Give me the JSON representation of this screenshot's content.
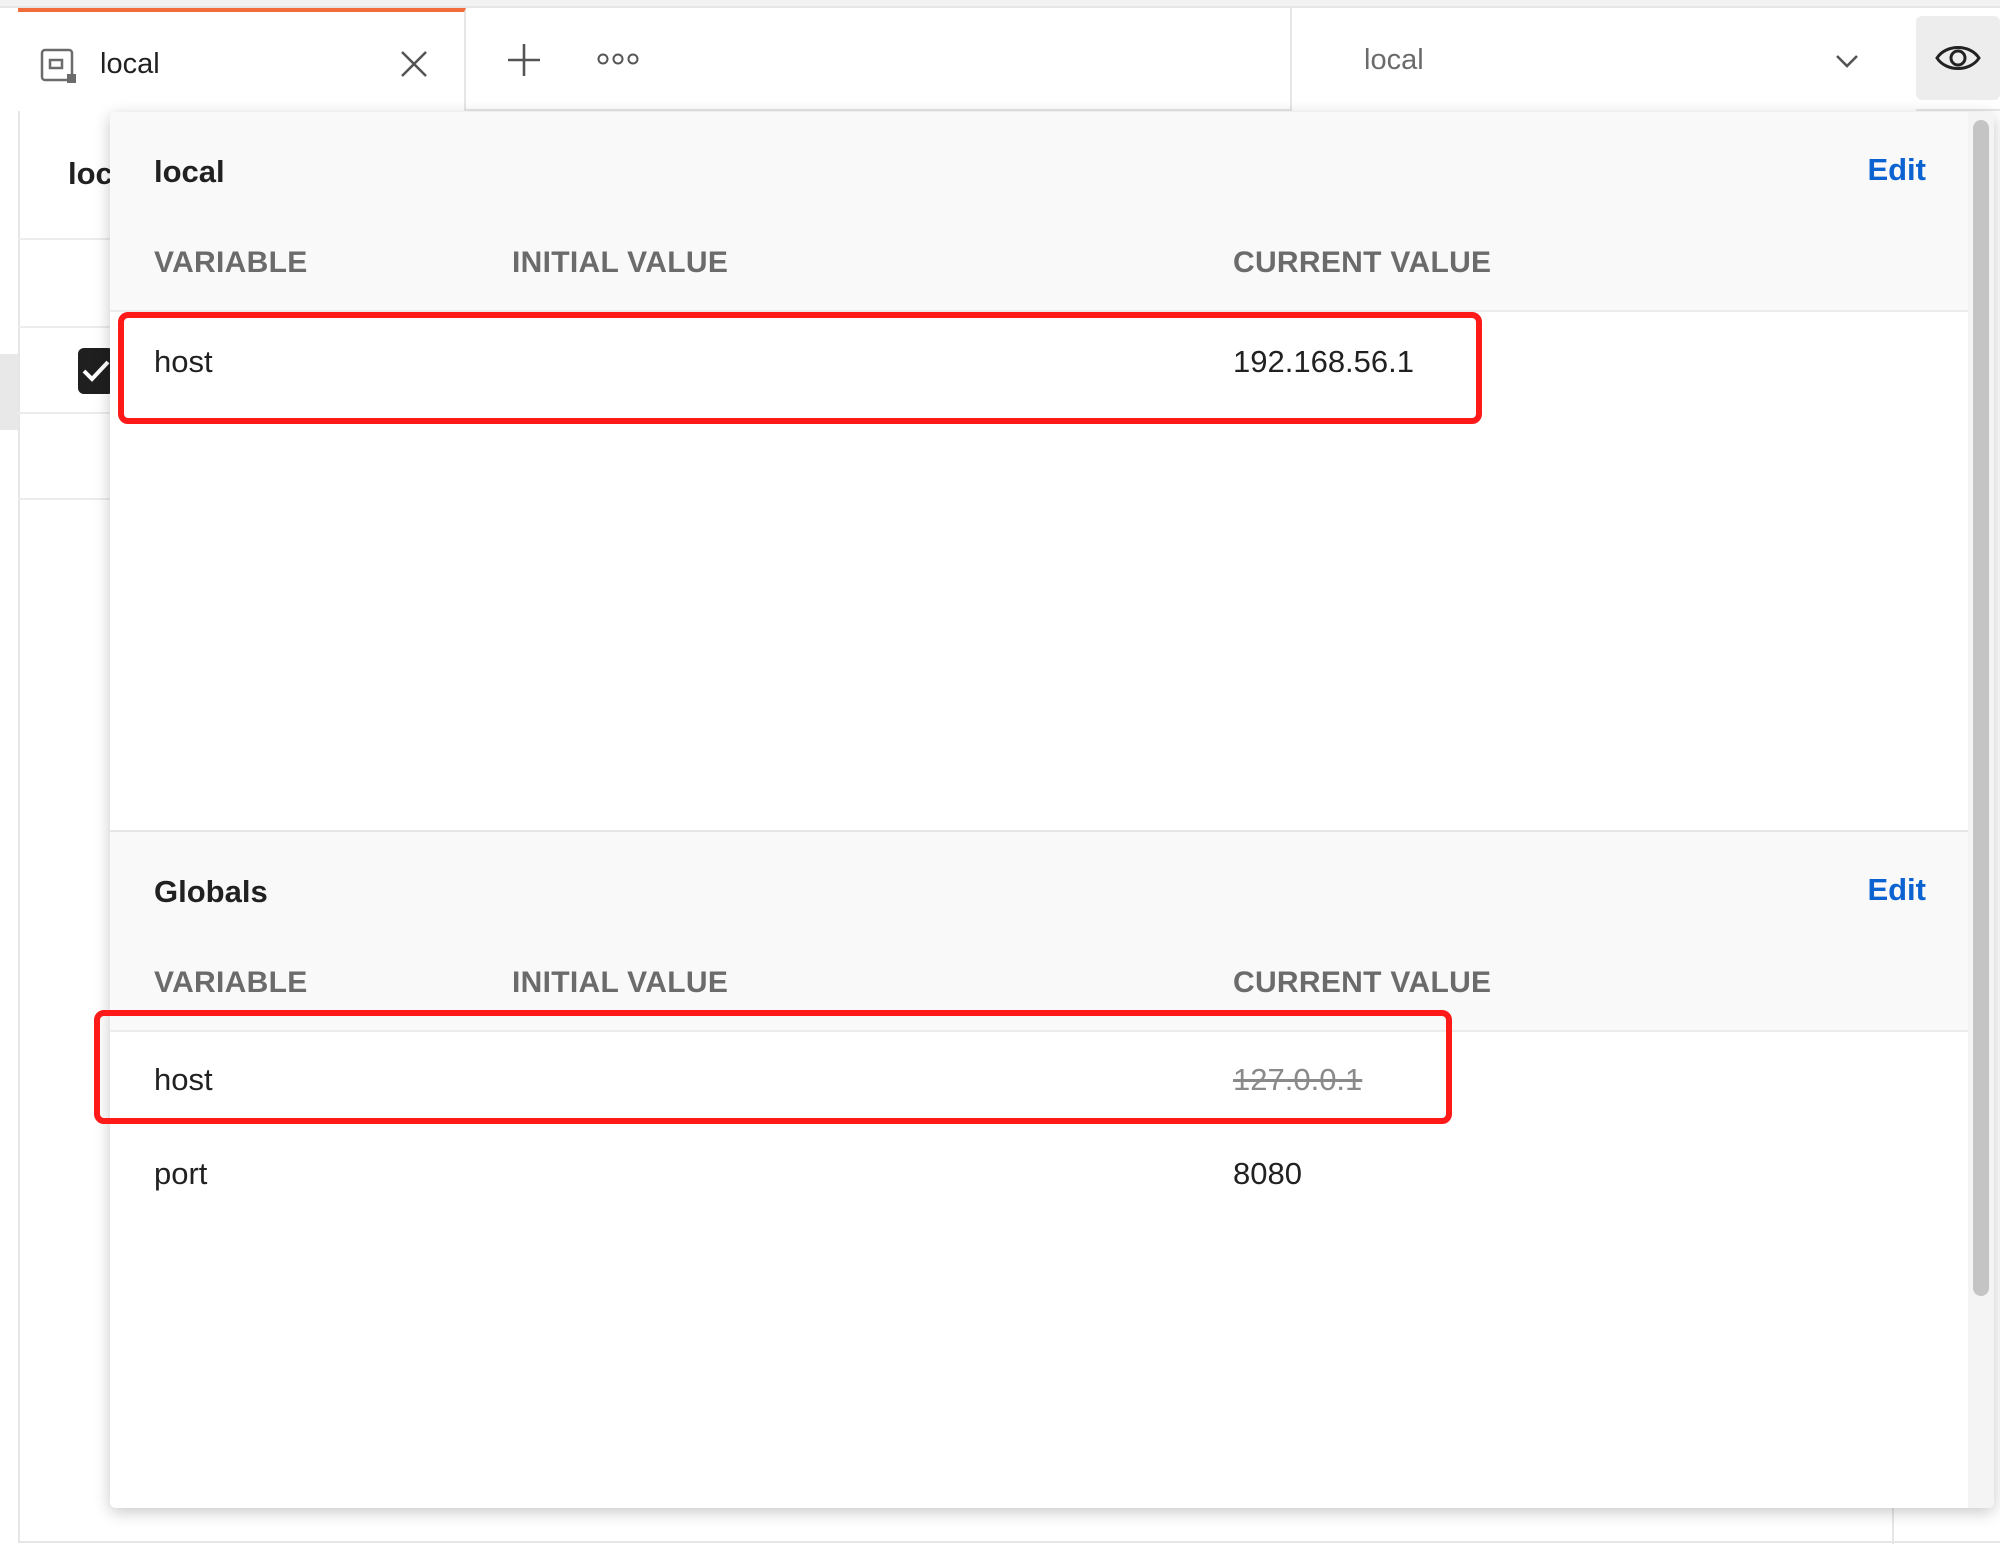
{
  "tab": {
    "label": "local",
    "icon": "environment-icon",
    "close_icon": "close-icon"
  },
  "toolbar": {
    "new_tab_icon": "plus-icon",
    "more_icon": "more-horizontal-icon"
  },
  "environment_selector": {
    "selected": "local",
    "chevron_icon": "chevron-down-icon",
    "quick_look_icon": "eye-icon"
  },
  "background": {
    "partial_label": "loc"
  },
  "popover": {
    "environment_section": {
      "title": "local",
      "edit_label": "Edit",
      "columns": [
        "VARIABLE",
        "INITIAL VALUE",
        "CURRENT VALUE"
      ],
      "rows": [
        {
          "variable": "host",
          "initial_value": "",
          "current_value": "192.168.56.1",
          "overridden": false
        }
      ]
    },
    "globals_section": {
      "title": "Globals",
      "edit_label": "Edit",
      "columns": [
        "VARIABLE",
        "INITIAL VALUE",
        "CURRENT VALUE"
      ],
      "rows": [
        {
          "variable": "host",
          "initial_value": "",
          "current_value": "127.0.0.1",
          "overridden": true
        },
        {
          "variable": "port",
          "initial_value": "",
          "current_value": "8080",
          "overridden": false
        }
      ]
    }
  },
  "colors": {
    "accent_tab": "#f26b3a",
    "edit_link": "#0b63d1",
    "highlight_box": "#ff1a1a"
  }
}
